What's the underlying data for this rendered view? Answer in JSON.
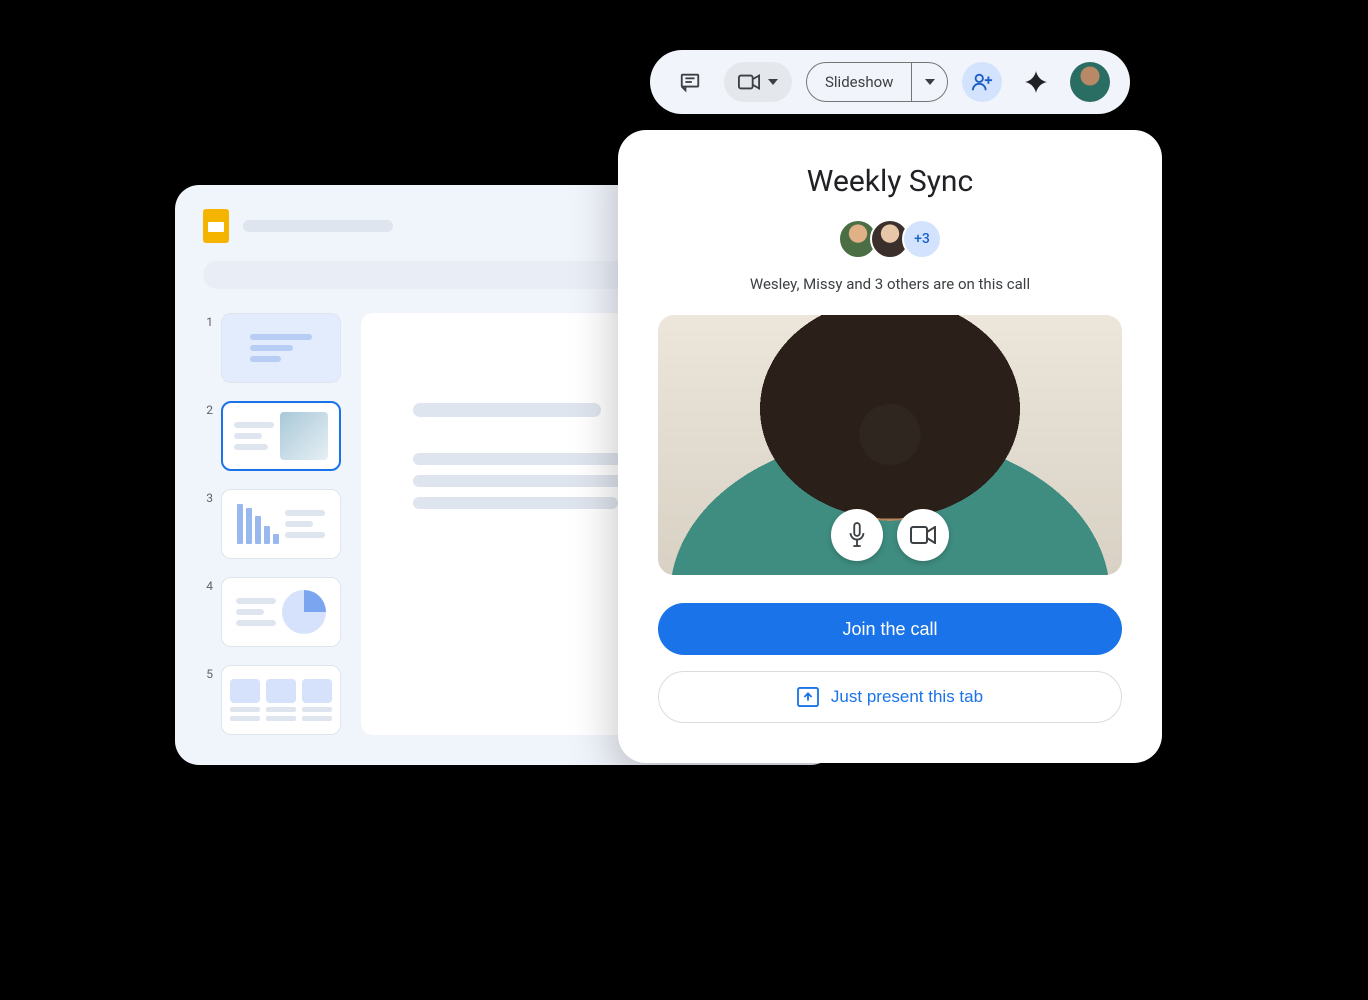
{
  "toolbar": {
    "slideshow_label": "Slideshow"
  },
  "thumbnails": {
    "numbers": [
      "1",
      "2",
      "3",
      "4",
      "5"
    ]
  },
  "meet": {
    "title": "Weekly Sync",
    "overflow_badge": "+3",
    "subtitle": "Wesley, Missy and 3 others are on this call",
    "join_label": "Join the call",
    "present_label": "Just present this tab"
  }
}
